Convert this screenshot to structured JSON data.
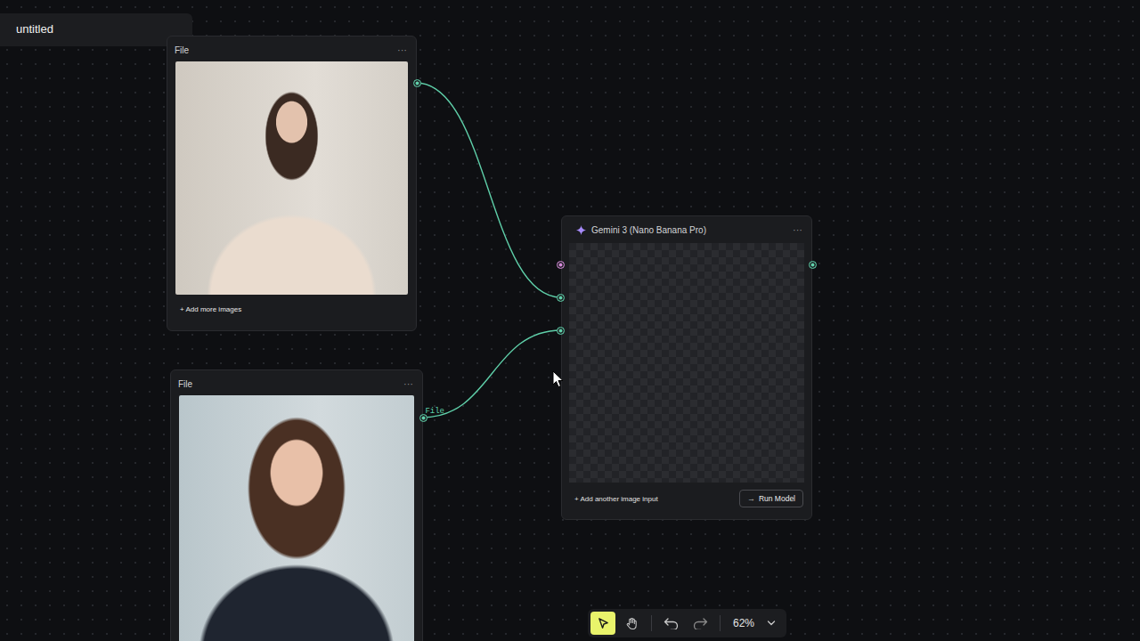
{
  "document": {
    "title": "untitled"
  },
  "file_nodes": [
    {
      "title": "File",
      "menu": "···",
      "footer": "+ Add more images"
    },
    {
      "title": "File",
      "menu": "···",
      "output_label": "File"
    }
  ],
  "model_node": {
    "title": "Gemini 3 (Nano Banana Pro)",
    "menu": "···",
    "inputs": [
      {
        "kind": "prompt",
        "connected": false
      },
      {
        "kind": "image",
        "connected": true
      },
      {
        "kind": "image",
        "connected": true
      }
    ],
    "add_input": "+ Add another image input",
    "run_icon": "→",
    "run_button": "Run Model"
  },
  "toolbar": {
    "tools": [
      {
        "name": "select",
        "selected": true
      },
      {
        "name": "hand",
        "selected": false
      }
    ],
    "zoom": "62%"
  }
}
